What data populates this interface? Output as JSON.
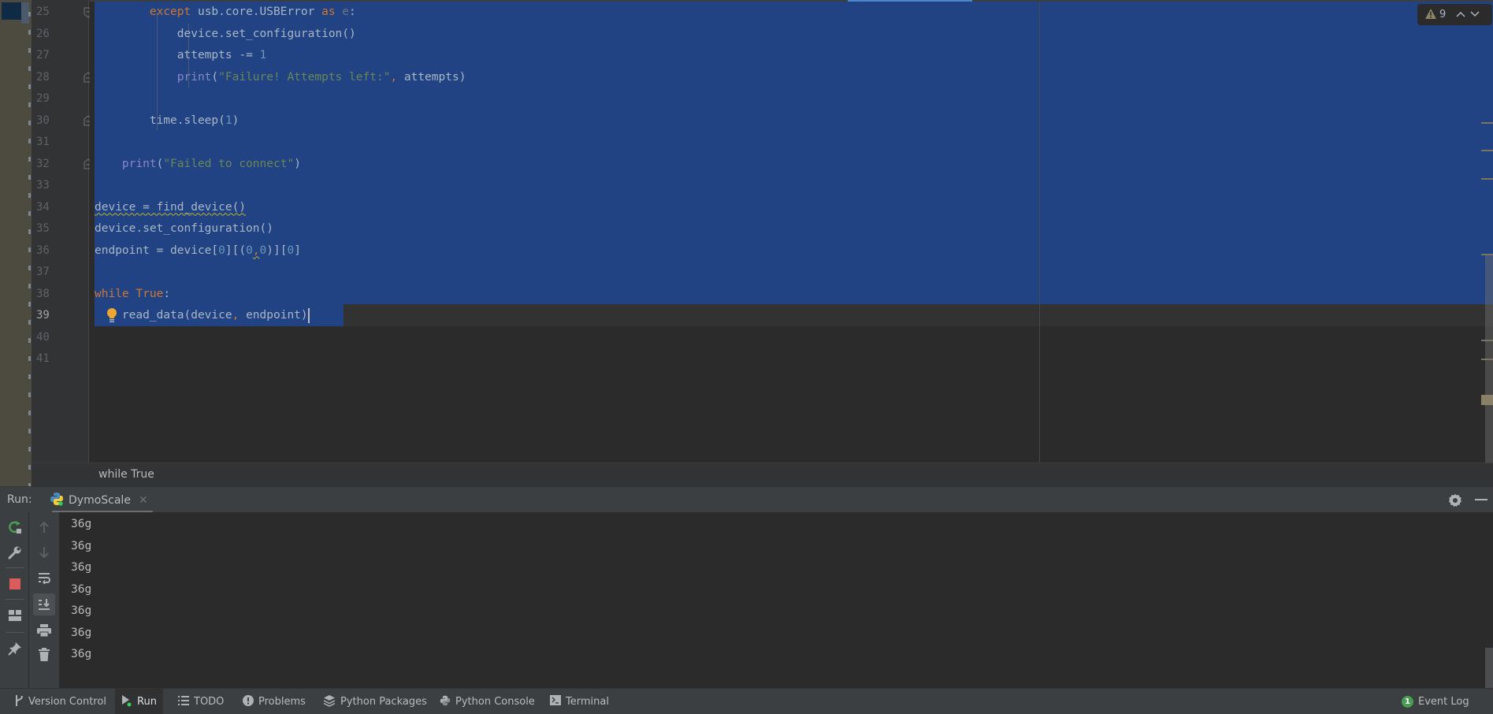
{
  "editor": {
    "lines": [
      {
        "number": "25"
      },
      {
        "number": "26"
      },
      {
        "number": "27"
      },
      {
        "number": "28"
      },
      {
        "number": "29"
      },
      {
        "number": "30"
      },
      {
        "number": "31"
      },
      {
        "number": "32"
      },
      {
        "number": "33"
      },
      {
        "number": "34"
      },
      {
        "number": "35"
      },
      {
        "number": "36"
      },
      {
        "number": "37"
      },
      {
        "number": "38"
      },
      {
        "number": "39"
      },
      {
        "number": "40"
      },
      {
        "number": "41"
      }
    ],
    "current_line": "39",
    "code": {
      "l25": {
        "kw1": "except",
        "t1": " usb.core.USBError ",
        "kw2": "as",
        "p1": " e",
        "t2": ":"
      },
      "l26": {
        "t1": "device.set_configuration()"
      },
      "l27": {
        "t1": "attempts -= ",
        "n1": "1"
      },
      "l28": {
        "b1": "print",
        "t1": "(",
        "s1": "\"Failure! Attempts left:\"",
        "c1": ",",
        "t2": " attempts)"
      },
      "l30": {
        "t1": "time.sleep(",
        "n1": "1",
        "t2": ")"
      },
      "l32": {
        "b1": "print",
        "t1": "(",
        "s1": "\"Failed to connect\"",
        "t2": ")"
      },
      "l34": {
        "t1": "device = find_device()"
      },
      "l35": {
        "t1": "device.set_configuration()"
      },
      "l36": {
        "t1": "endpoint = device[",
        "n1": "0",
        "t2": "][(",
        "n2": "0",
        "c1": ",",
        "n3": "0",
        "t3": ")][",
        "n4": "0",
        "t4": "]"
      },
      "l38": {
        "kw1": "while",
        "t1": " ",
        "kw2": "True",
        "t2": ":"
      },
      "l39": {
        "t1": "read_data(device",
        "c1": ",",
        "t2": " endpoint)"
      }
    },
    "inspection": {
      "warning_icon": "warning-triangle-icon",
      "warning_count": "9",
      "prev_label": "^",
      "next_label": "v"
    },
    "breadcrumb": "while True"
  },
  "run_window": {
    "label": "Run:",
    "tab": {
      "title": "DymoScale",
      "icon": "python-icon"
    },
    "toolbar_left": [
      "rerun-icon",
      "wrench-icon",
      "stop-icon",
      "layout-icon",
      "pin-icon"
    ],
    "toolbar_right": [
      "up-arrow-icon",
      "down-arrow-icon",
      "soft-wrap-icon",
      "scroll-to-end-icon",
      "print-icon",
      "trash-icon"
    ],
    "output": [
      "36g",
      "36g",
      "36g",
      "36g",
      "36g",
      "36g",
      "36g"
    ]
  },
  "bottom_bar": {
    "items": [
      {
        "label": "Version Control",
        "icon": "branch-icon"
      },
      {
        "label": "Run",
        "icon": "run-icon",
        "active": true
      },
      {
        "label": "TODO",
        "icon": "list-icon"
      },
      {
        "label": "Problems",
        "icon": "problems-icon"
      },
      {
        "label": "Python Packages",
        "icon": "packages-icon"
      },
      {
        "label": "Python Console",
        "icon": "python-console-icon"
      },
      {
        "label": "Terminal",
        "icon": "terminal-icon"
      }
    ],
    "event_log": {
      "label": "Event Log",
      "count": "1"
    }
  },
  "colors": {
    "selection": "#214283",
    "keyword": "#cc7832",
    "string": "#6a8759",
    "number": "#6897bb",
    "builtin": "#8888c6",
    "text": "#a9b7c6"
  }
}
